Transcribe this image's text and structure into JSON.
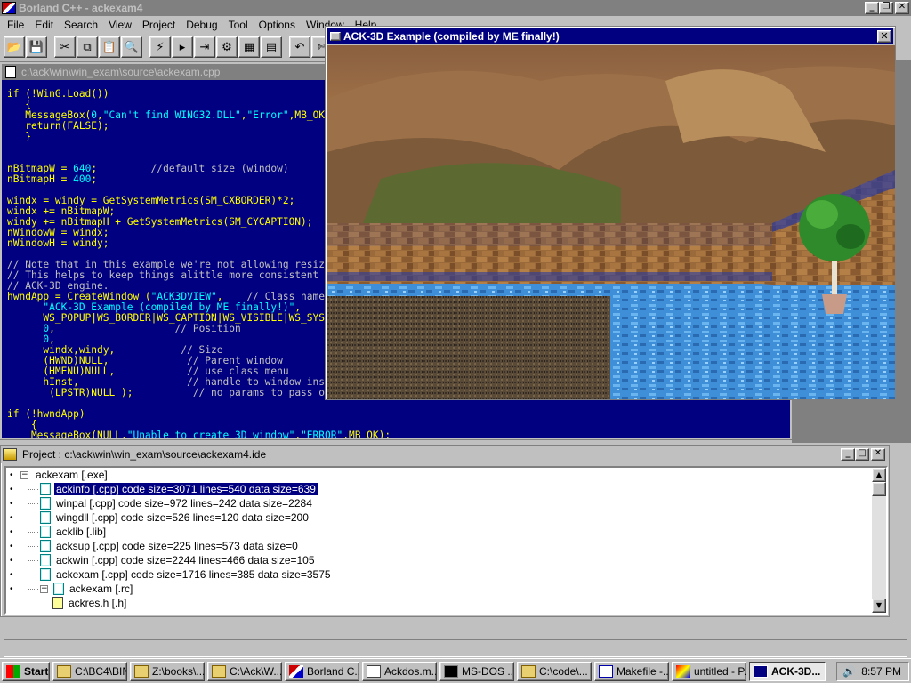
{
  "ide": {
    "title": "Borland C++ - ackexam4",
    "menu": [
      "File",
      "Edit",
      "Search",
      "View",
      "Project",
      "Debug",
      "Tool",
      "Options",
      "Window",
      "Help"
    ],
    "toolbar_icons": [
      "open-file-icon",
      "save-file-icon",
      "cut-icon",
      "copy-icon",
      "paste-icon",
      "search-icon",
      "replace-icon",
      "undo-icon",
      "run-icon",
      "step-icon",
      "trace-icon",
      "compile-icon",
      "build-icon",
      "make-icon",
      "help-icon",
      "tool-icon",
      "break-icon"
    ]
  },
  "editor": {
    "title": "c:\\ack\\win\\win_exam\\source\\ackexam.cpp"
  },
  "ack": {
    "title": "ACK-3D Example (compiled by ME finally!)",
    "close_label": "✕"
  },
  "project": {
    "title": "Project : c:\\ack\\win\\win_exam\\source\\ackexam4.ide",
    "root": "ackexam [.exe]",
    "items": [
      {
        "label": "ackinfo [.cpp]  code size=3071  lines=540  data size=639",
        "selected": true
      },
      {
        "label": "winpal [.cpp]  code size=972  lines=242  data size=2284"
      },
      {
        "label": "wingdll [.cpp]  code size=526  lines=120  data size=200"
      },
      {
        "label": "acklib [.lib]"
      },
      {
        "label": "acksup [.cpp]  code size=225  lines=573  data size=0"
      },
      {
        "label": "ackwin [.cpp]  code size=2244  lines=466  data size=105"
      },
      {
        "label": "ackexam [.cpp]  code size=1716  lines=385  data size=3575"
      },
      {
        "label": "ackexam [.rc]"
      }
    ],
    "child": "ackres.h [.h]"
  },
  "taskbar": {
    "start_label": "Start",
    "tasks": [
      {
        "label": "C:\\BC4\\BIN",
        "icon": "folder-icon"
      },
      {
        "label": "Z:\\books\\...",
        "icon": "folder-icon"
      },
      {
        "label": "C:\\Ack\\W...",
        "icon": "folder-icon"
      },
      {
        "label": "Borland C...",
        "icon": "borland-icon"
      },
      {
        "label": "Ackdos.m...",
        "icon": "document-icon"
      },
      {
        "label": "MS-DOS ...",
        "icon": "msdos-icon"
      },
      {
        "label": "C:\\code\\...",
        "icon": "folder-icon"
      },
      {
        "label": "Makefile -...",
        "icon": "notepad-icon"
      },
      {
        "label": "untitled - P...",
        "icon": "paint-icon"
      },
      {
        "label": "ACK-3D...",
        "icon": "ack-icon",
        "active": true
      }
    ],
    "clock": "8:57 PM"
  }
}
